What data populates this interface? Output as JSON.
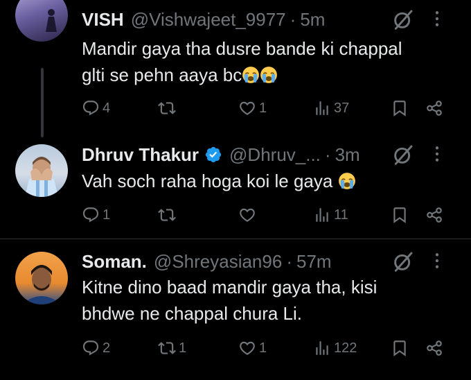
{
  "tweets": [
    {
      "name": "VISH",
      "handle": "@Vishwajeet_9977",
      "dot": "·",
      "time": "5m",
      "text_line1": "Mandir gaya tha dusre bande ki chappal",
      "text_line2": "glti se pehn aaya bc",
      "replies": "4",
      "retweets": "",
      "likes": "1",
      "views": "37"
    },
    {
      "name": "Dhruv Thakur",
      "handle": "@Dhruv_...",
      "dot": "·",
      "time": "3m",
      "verified": true,
      "text_line1": "Vah soch raha hoga koi le gaya",
      "replies": "1",
      "retweets": "",
      "likes": "",
      "views": "11"
    },
    {
      "name": "Soman.",
      "handle": "@Shreyasian96",
      "dot": "·",
      "time": "57m",
      "text_line1": "Kitne dino baad mandir gaya tha, kisi",
      "text_line2": "bhdwe ne chappal chura Li.",
      "replies": "2",
      "retweets": "1",
      "likes": "1",
      "views": "122"
    }
  ],
  "colors": {
    "background": "#000000",
    "text": "#e7e9ea",
    "muted": "#71767b",
    "divider": "#2f3336",
    "verified": "#1d9bf0"
  },
  "icons": [
    "grok-icon",
    "more-icon",
    "reply-icon",
    "retweet-icon",
    "like-icon",
    "views-icon",
    "bookmark-icon",
    "share-icon",
    "loudly-crying-emoji"
  ]
}
